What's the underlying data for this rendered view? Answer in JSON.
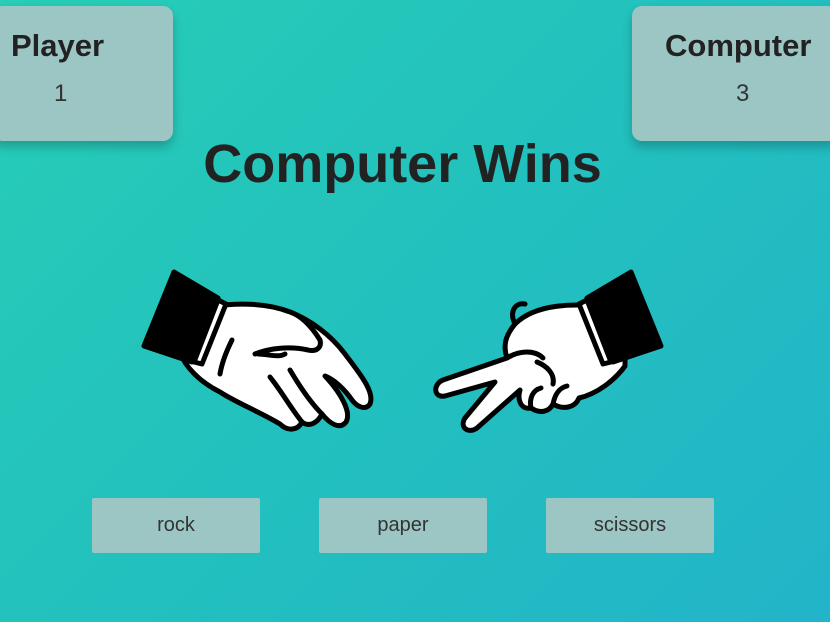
{
  "scoreboard": {
    "player": {
      "label": "Player",
      "score": "1"
    },
    "computer": {
      "label": "Computer",
      "score": "3"
    }
  },
  "result_text": "Computer Wins",
  "hands": {
    "player_choice_icon": "paper-hand-icon",
    "computer_choice_icon": "scissors-hand-icon"
  },
  "buttons": {
    "rock": "rock",
    "paper": "paper",
    "scissors": "scissors"
  },
  "colors": {
    "background_start": "#27cdb6",
    "background_end": "#22b4c8",
    "card": "#9cc6c4",
    "text": "#222222"
  }
}
